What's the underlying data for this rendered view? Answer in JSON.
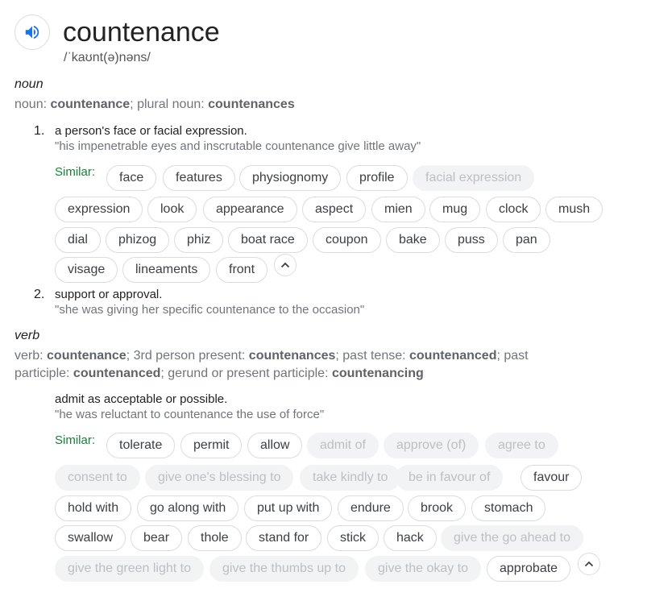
{
  "headword": {
    "word": "countenance",
    "phonetic": "/ˈkaʊnt(ə)nəns/",
    "speaker_icon": "speaker-icon"
  },
  "noun": {
    "pos": "noun",
    "forms": [
      {
        "t": "noun: ",
        "b": false
      },
      {
        "t": "countenance",
        "b": true
      },
      {
        "t": "; plural noun: ",
        "b": false
      },
      {
        "t": "countenances",
        "b": true
      }
    ],
    "senses": [
      {
        "num": "1.",
        "definition": "a person's face or facial expression.",
        "example": "\"his impenetrable eyes and inscrutable countenance give little away\"",
        "similar_label": "Similar:",
        "chips": [
          {
            "label": "face",
            "muted": false
          },
          {
            "label": "features",
            "muted": false
          },
          {
            "label": "physiognomy",
            "muted": false
          },
          {
            "label": "profile",
            "muted": false
          },
          {
            "label": "facial expression",
            "muted": true
          },
          {
            "label": "expression",
            "muted": false
          },
          {
            "label": "look",
            "muted": false
          },
          {
            "label": "appearance",
            "muted": false
          },
          {
            "label": "aspect",
            "muted": false
          },
          {
            "label": "mien",
            "muted": false
          },
          {
            "label": "mug",
            "muted": false
          },
          {
            "label": "clock",
            "muted": false
          },
          {
            "label": "mush",
            "muted": false
          },
          {
            "label": "dial",
            "muted": false
          },
          {
            "label": "phizog",
            "muted": false
          },
          {
            "label": "phiz",
            "muted": false
          },
          {
            "label": "boat race",
            "muted": false
          },
          {
            "label": "coupon",
            "muted": false
          },
          {
            "label": "bake",
            "muted": false
          },
          {
            "label": "puss",
            "muted": false
          },
          {
            "label": "pan",
            "muted": false
          },
          {
            "label": "visage",
            "muted": false
          },
          {
            "label": "lineaments",
            "muted": false
          },
          {
            "label": "front",
            "muted": false
          }
        ]
      },
      {
        "num": "2.",
        "definition": "support or approval.",
        "example": "\"she was giving her specific countenance to the occasion\""
      }
    ]
  },
  "verb": {
    "pos": "verb",
    "forms": [
      {
        "t": "verb: ",
        "b": false
      },
      {
        "t": "countenance",
        "b": true
      },
      {
        "t": "; 3rd person present: ",
        "b": false
      },
      {
        "t": "countenances",
        "b": true
      },
      {
        "t": "; past tense: ",
        "b": false
      },
      {
        "t": "countenanced",
        "b": true
      },
      {
        "t": "; past participle: ",
        "b": false
      },
      {
        "t": "countenanced",
        "b": true
      },
      {
        "t": "; gerund or present participle: ",
        "b": false
      },
      {
        "t": "countenancing",
        "b": true
      }
    ],
    "definition": "admit as acceptable or possible.",
    "example": "\"he was reluctant to countenance the use of force\"",
    "similar_label": "Similar:",
    "chips": [
      {
        "label": "tolerate",
        "muted": false
      },
      {
        "label": "permit",
        "muted": false
      },
      {
        "label": "allow",
        "muted": false
      },
      {
        "label": "admit of",
        "muted": true
      },
      {
        "label": "approve (of)",
        "muted": true
      },
      {
        "label": "agree to",
        "muted": true
      },
      {
        "label": "consent to",
        "muted": true
      },
      {
        "label": "give one's blessing to",
        "muted": true
      },
      {
        "label": "take kindly to",
        "muted": true
      },
      {
        "label": "be in favour of",
        "muted": true
      },
      {
        "label": "favour",
        "muted": false
      },
      {
        "label": "hold with",
        "muted": false
      },
      {
        "label": "go along with",
        "muted": false
      },
      {
        "label": "put up with",
        "muted": false
      },
      {
        "label": "endure",
        "muted": false
      },
      {
        "label": "brook",
        "muted": false
      },
      {
        "label": "stomach",
        "muted": false
      },
      {
        "label": "swallow",
        "muted": false
      },
      {
        "label": "bear",
        "muted": false
      },
      {
        "label": "thole",
        "muted": false
      },
      {
        "label": "stand for",
        "muted": false
      },
      {
        "label": "stick",
        "muted": false
      },
      {
        "label": "hack",
        "muted": false
      },
      {
        "label": "give the go ahead to",
        "muted": true
      },
      {
        "label": "give the green light to",
        "muted": true
      },
      {
        "label": "give the thumbs up to",
        "muted": true
      },
      {
        "label": "give the okay to",
        "muted": true
      },
      {
        "label": "approbate",
        "muted": false
      }
    ]
  },
  "icons": {
    "collapse": "chevron-up-icon"
  },
  "colors": {
    "similar_label": "#188038",
    "speaker": "#1a73e8",
    "muted_chip_bg": "#f1f3f4"
  }
}
